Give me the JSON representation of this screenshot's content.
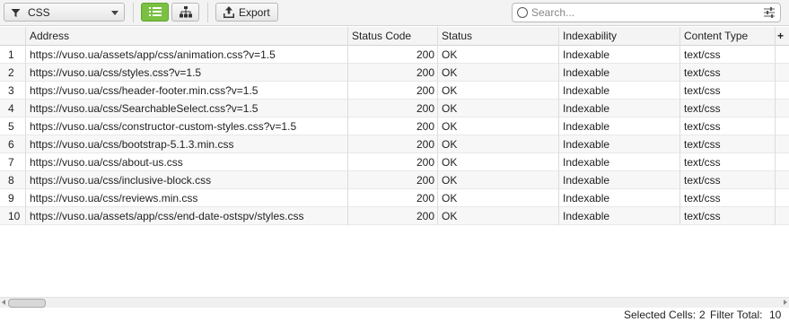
{
  "toolbar": {
    "filter_value": "CSS",
    "export_label": "Export",
    "search_placeholder": "Search..."
  },
  "columns": {
    "address": "Address",
    "status_code": "Status Code",
    "status": "Status",
    "indexability": "Indexability",
    "content_type": "Content Type",
    "add": "+"
  },
  "rows": [
    {
      "idx": "1",
      "address": "https://vuso.ua/assets/app/css/animation.css?v=1.5",
      "status_code": "200",
      "status": "OK",
      "indexability": "Indexable",
      "content_type": "text/css"
    },
    {
      "idx": "2",
      "address": "https://vuso.ua/css/styles.css?v=1.5",
      "status_code": "200",
      "status": "OK",
      "indexability": "Indexable",
      "content_type": "text/css"
    },
    {
      "idx": "3",
      "address": "https://vuso.ua/css/header-footer.min.css?v=1.5",
      "status_code": "200",
      "status": "OK",
      "indexability": "Indexable",
      "content_type": "text/css"
    },
    {
      "idx": "4",
      "address": "https://vuso.ua/css/SearchableSelect.css?v=1.5",
      "status_code": "200",
      "status": "OK",
      "indexability": "Indexable",
      "content_type": "text/css"
    },
    {
      "idx": "5",
      "address": "https://vuso.ua/css/constructor-custom-styles.css?v=1.5",
      "status_code": "200",
      "status": "OK",
      "indexability": "Indexable",
      "content_type": "text/css"
    },
    {
      "idx": "6",
      "address": "https://vuso.ua/css/bootstrap-5.1.3.min.css",
      "status_code": "200",
      "status": "OK",
      "indexability": "Indexable",
      "content_type": "text/css"
    },
    {
      "idx": "7",
      "address": "https://vuso.ua/css/about-us.css",
      "status_code": "200",
      "status": "OK",
      "indexability": "Indexable",
      "content_type": "text/css"
    },
    {
      "idx": "8",
      "address": "https://vuso.ua/css/inclusive-block.css",
      "status_code": "200",
      "status": "OK",
      "indexability": "Indexable",
      "content_type": "text/css"
    },
    {
      "idx": "9",
      "address": "https://vuso.ua/css/reviews.min.css",
      "status_code": "200",
      "status": "OK",
      "indexability": "Indexable",
      "content_type": "text/css"
    },
    {
      "idx": "10",
      "address": "https://vuso.ua/assets/app/css/end-date-ostspv/styles.css",
      "status_code": "200",
      "status": "OK",
      "indexability": "Indexable",
      "content_type": "text/css"
    }
  ],
  "status_bar": {
    "selected_cells_label": "Selected Cells:",
    "selected_cells_value": "2",
    "filter_total_label": "Filter Total:",
    "filter_total_value": "10"
  },
  "colors": {
    "active_view_button": "#7bc043"
  },
  "icons": [
    "filter-icon",
    "list-view-icon",
    "tree-view-icon",
    "export-icon",
    "search-icon",
    "search-options-icon"
  ]
}
